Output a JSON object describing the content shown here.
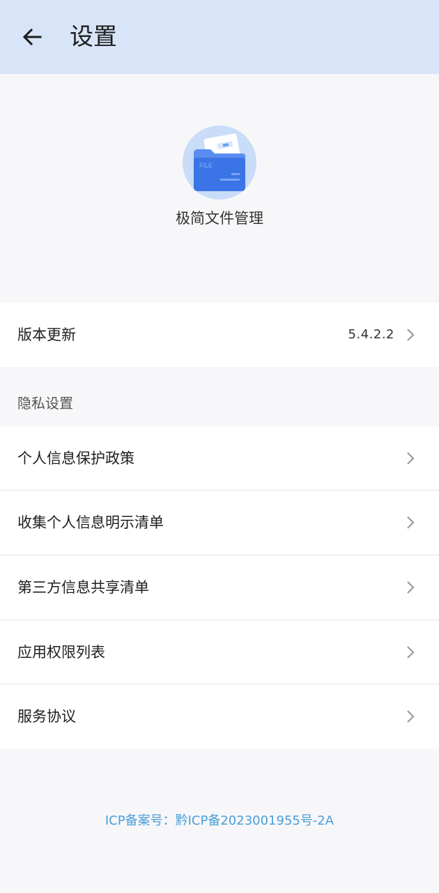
{
  "header": {
    "title": "设置",
    "back_icon": "arrow-left-icon"
  },
  "app_info": {
    "name": "极简文件管理",
    "logo_icon": "file-folder-icon",
    "logo_text": "FILE"
  },
  "version_row": {
    "label": "版本更新",
    "value": "5.4.2.2"
  },
  "privacy_section": {
    "title": "隐私设置",
    "items": [
      {
        "label": "个人信息保护政策"
      },
      {
        "label": "收集个人信息明示清单"
      },
      {
        "label": "第三方信息共享清单"
      },
      {
        "label": "应用权限列表"
      },
      {
        "label": "服务协议"
      }
    ]
  },
  "footer": {
    "icp": "ICP备案号：黔ICP备2023001955号-2A"
  },
  "colors": {
    "header_bg": "#d8e4f7",
    "link": "#4a9fd8",
    "folder": "#3b74e6"
  }
}
